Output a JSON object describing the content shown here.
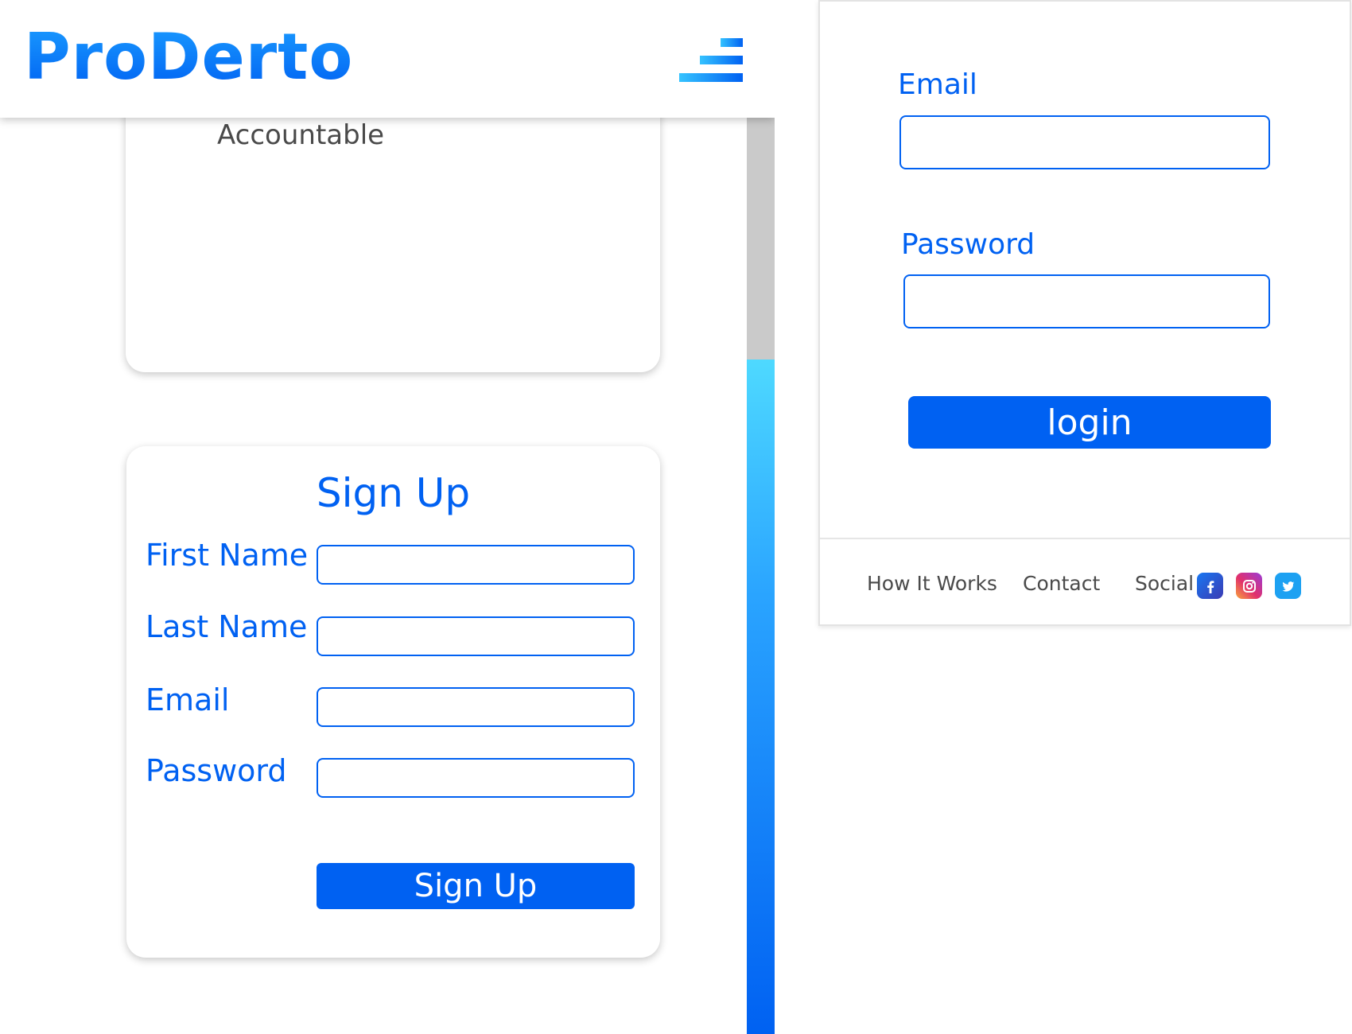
{
  "header": {
    "logo": "ProDerto",
    "menu_icon": "hamburger-menu-icon"
  },
  "feature_card": {
    "text": "Accountable"
  },
  "signup": {
    "title": "Sign Up",
    "fields": [
      {
        "label": "First Name",
        "value": ""
      },
      {
        "label": "Last Name",
        "value": ""
      },
      {
        "label": "Email",
        "value": ""
      },
      {
        "label": "Password",
        "value": ""
      }
    ],
    "button_label": "Sign Up"
  },
  "login": {
    "email_label": "Email",
    "email_value": "",
    "password_label": "Password",
    "password_value": "",
    "button_label": "login"
  },
  "footer": {
    "links": [
      "How It Works",
      "Contact",
      "Social"
    ],
    "social_icons": [
      "facebook-icon",
      "instagram-icon",
      "twitter-icon"
    ]
  },
  "colors": {
    "accent": "#0061f2",
    "gradient_light": "#4ed9ff",
    "text_gray": "#4a4a4a",
    "scroll_track": "#cacaca"
  }
}
